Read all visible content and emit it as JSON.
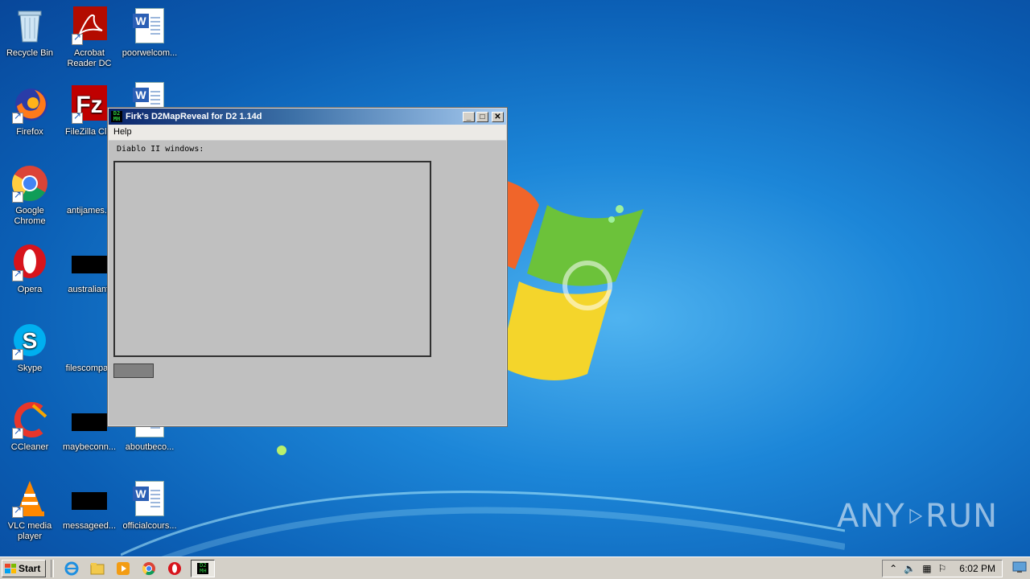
{
  "desktop": {
    "icons": [
      {
        "label": "Recycle Bin",
        "icon": "recycle-bin-icon"
      },
      {
        "label": "Acrobat Reader DC",
        "icon": "acrobat-reader-icon"
      },
      {
        "label": "poorwelcom...",
        "icon": "word-document-icon"
      },
      {
        "label": "Firefox",
        "icon": "firefox-icon"
      },
      {
        "label": "FileZilla Clie",
        "icon": "filezilla-icon"
      },
      {
        "label": "Google Chrome",
        "icon": "chrome-icon"
      },
      {
        "label": "antijames.p",
        "icon": "document-icon"
      },
      {
        "label": "Opera",
        "icon": "opera-icon"
      },
      {
        "label": "australianfl",
        "icon": "document-icon"
      },
      {
        "label": "Skype",
        "icon": "skype-icon"
      },
      {
        "label": "filescompan",
        "icon": "document-icon"
      },
      {
        "label": "CCleaner",
        "icon": "ccleaner-icon"
      },
      {
        "label": "maybeconn...",
        "icon": "document-icon"
      },
      {
        "label": "aboutbeco...",
        "icon": "word-document-icon"
      },
      {
        "label": "VLC media player",
        "icon": "vlc-icon"
      },
      {
        "label": "messageed...",
        "icon": "document-icon"
      },
      {
        "label": "officialcours...",
        "icon": "word-document-icon"
      }
    ]
  },
  "window": {
    "title": "Firk's D2MapReveal for D2 1.14d",
    "app_icon_text": "D2 MH",
    "menu": [
      "Help"
    ],
    "label": "Diablo II windows:",
    "controls": {
      "minimize": "_",
      "maximize": "□",
      "close": "✕"
    }
  },
  "taskbar": {
    "start_label": "Start",
    "pinned": [
      "internet-explorer-icon",
      "file-explorer-icon",
      "media-player-icon",
      "chrome-icon",
      "opera-icon"
    ],
    "active_app": "d2mapreveal-icon",
    "clock": "6:02 PM"
  },
  "watermark": {
    "text_left": "ANY",
    "text_right": "RUN"
  },
  "colors": {
    "titlebar_start": "#0a246a",
    "titlebar_end": "#a6caf0",
    "window_bg": "#c0c0c0",
    "taskbar_bg": "#d4d0c8"
  }
}
